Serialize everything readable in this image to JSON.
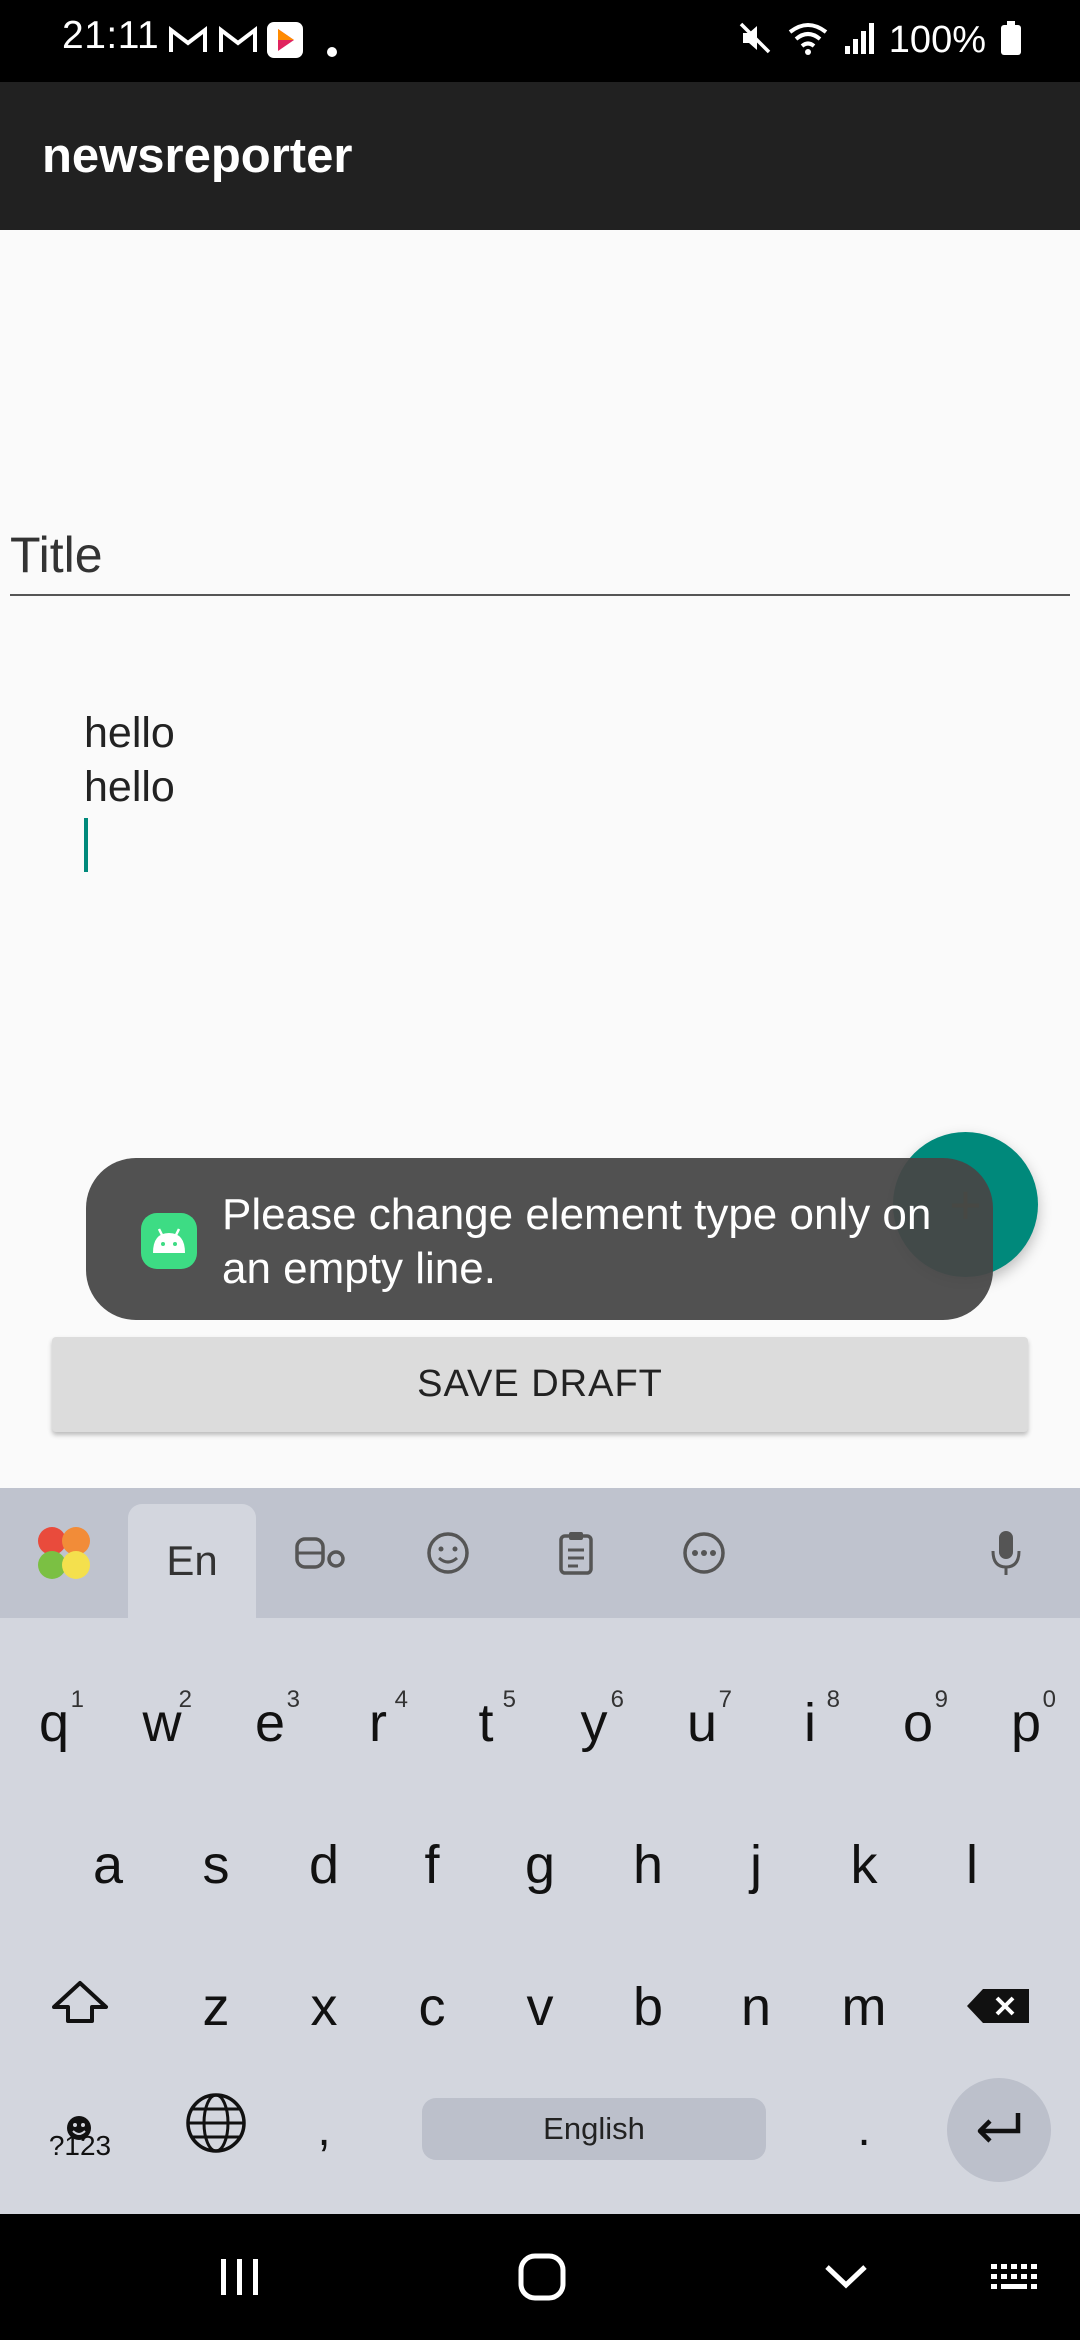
{
  "status_bar": {
    "time": "21:11",
    "battery": "100%",
    "icons": [
      "gmail-icon",
      "gmail-icon",
      "app-notification-icon",
      "dot-icon",
      "mute-icon",
      "wifi-icon",
      "signal-icon",
      "battery-icon"
    ]
  },
  "app_bar": {
    "title": "newsreporter"
  },
  "editor": {
    "title_placeholder": "Title",
    "lines": [
      "hello",
      "hello"
    ]
  },
  "fab": {
    "label": "+"
  },
  "toast": {
    "message": "Please change element type only on an empty line."
  },
  "save_button": {
    "label": "SAVE DRAFT"
  },
  "keyboard": {
    "toolbar": [
      {
        "name": "palette-icon"
      },
      {
        "name": "language-tab",
        "label": "En",
        "active": true
      },
      {
        "name": "sticker-icon"
      },
      {
        "name": "emoji-icon"
      },
      {
        "name": "clipboard-icon"
      },
      {
        "name": "more-icon"
      },
      {
        "name": "mic-icon"
      }
    ],
    "row1": [
      {
        "k": "q",
        "h": "1"
      },
      {
        "k": "w",
        "h": "2"
      },
      {
        "k": "e",
        "h": "3"
      },
      {
        "k": "r",
        "h": "4"
      },
      {
        "k": "t",
        "h": "5"
      },
      {
        "k": "y",
        "h": "6"
      },
      {
        "k": "u",
        "h": "7"
      },
      {
        "k": "i",
        "h": "8"
      },
      {
        "k": "o",
        "h": "9"
      },
      {
        "k": "p",
        "h": "0"
      }
    ],
    "row2": [
      "a",
      "s",
      "d",
      "f",
      "g",
      "h",
      "j",
      "k",
      "l"
    ],
    "row3": [
      "z",
      "x",
      "c",
      "v",
      "b",
      "n",
      "m"
    ],
    "symbols_label": "?123",
    "comma": ",",
    "space_label": "English",
    "period": "."
  },
  "colors": {
    "accent": "#00897b",
    "app_bar": "#212121",
    "keyboard_bg": "#d3d6de",
    "toolbar_bg": "#bfc3ce"
  }
}
